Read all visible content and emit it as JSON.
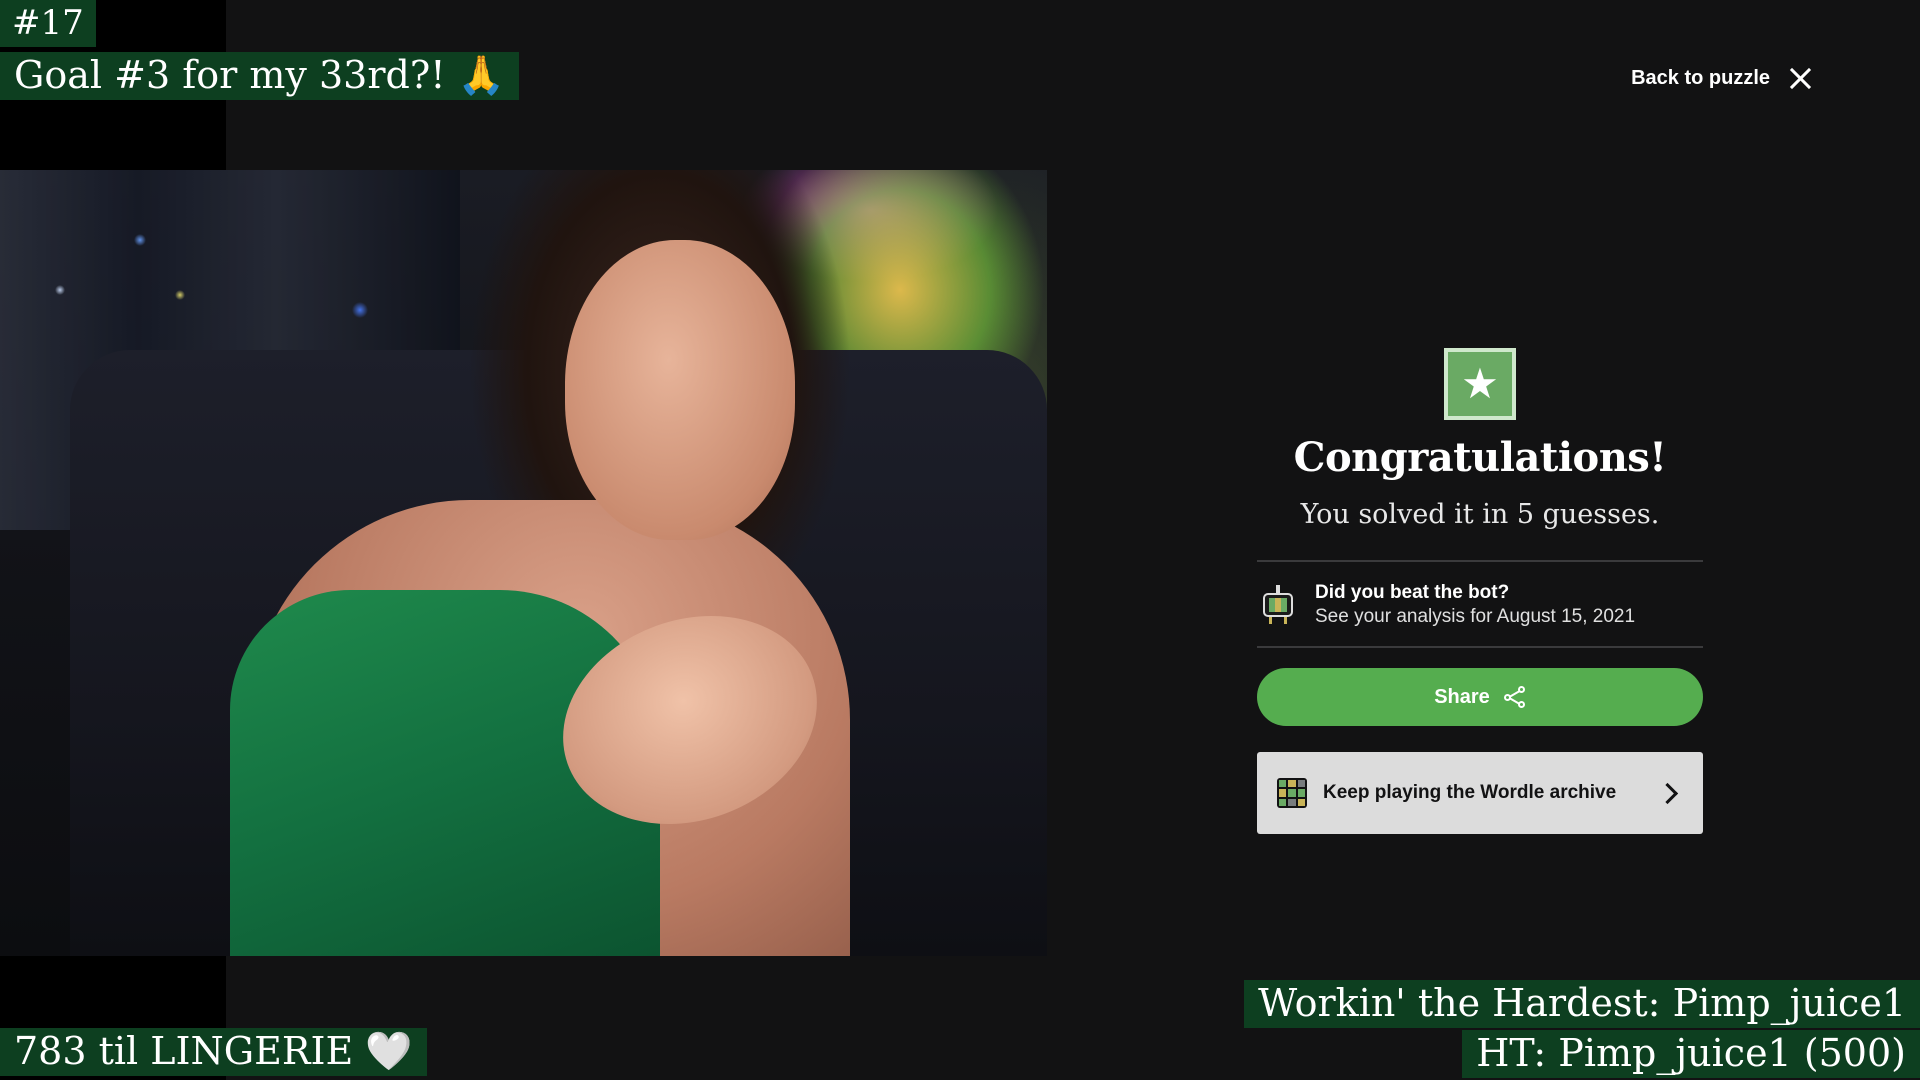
{
  "overlays": {
    "counter": "#17",
    "goal": "Goal #3 for my 33rd?! 🙏",
    "bottom_left": "783 til LINGERIE 🤍",
    "working_hardest": "Workin' the Hardest: Pimp_juice1",
    "ht": "HT: Pimp_juice1 (500)"
  },
  "header": {
    "back_link": "Back to puzzle"
  },
  "panel": {
    "star_symbol": "★",
    "title": "Congratulations!",
    "subtitle": "You solved it in 5 guesses.",
    "bot": {
      "title": "Did you beat the bot?",
      "subtitle": "See your analysis for August 15, 2021"
    },
    "share_label": "Share",
    "archive_label": "Keep playing the Wordle archive"
  },
  "icons": {
    "close": "close-icon",
    "star": "star-icon",
    "bot": "wordlebot-icon",
    "share": "share-icon",
    "archive_grid": "grid-icon",
    "chevron": "chevron-right-icon"
  },
  "colors": {
    "background": "#121213",
    "overlay_green": "#0d3f20",
    "wordle_green": "#6aaa64",
    "share_button": "#55ad4f",
    "wordle_yellow": "#c9b458",
    "archive_button": "#dcdcdc"
  },
  "archive_grid_colors": [
    "#6aaa64",
    "#c9b458",
    "#787c7e",
    "#c9b458",
    "#6aaa64",
    "#6aaa64",
    "#6aaa64",
    "#787c7e",
    "#c9b458"
  ]
}
